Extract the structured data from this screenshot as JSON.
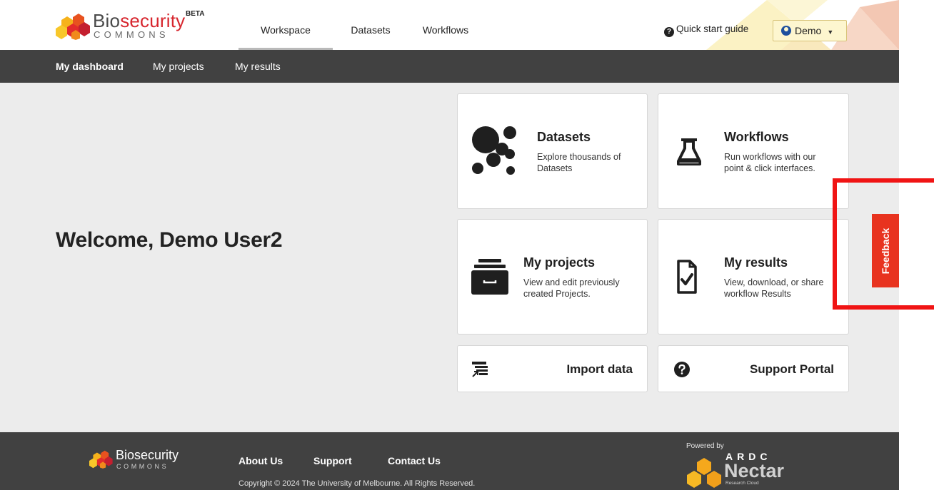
{
  "header": {
    "brand_part1": "Bio",
    "brand_part2": "security",
    "brand_sub": "COMMONS",
    "beta": "BETA",
    "tabs": [
      {
        "label": "Workspace",
        "active": true
      },
      {
        "label": "Datasets",
        "active": false
      },
      {
        "label": "Workflows",
        "active": false
      }
    ],
    "quick_start": "Quick start guide",
    "user_label": "Demo"
  },
  "subnav": {
    "items": [
      {
        "label": "My dashboard",
        "active": true
      },
      {
        "label": "My projects",
        "active": false
      },
      {
        "label": "My results",
        "active": false
      }
    ]
  },
  "main": {
    "welcome": "Welcome, Demo User2",
    "cards": {
      "datasets": {
        "title": "Datasets",
        "desc1": "Explore thousands of",
        "desc2": "Datasets",
        "icon": "datasets-dots-icon"
      },
      "workflows": {
        "title": "Workflows",
        "desc1": "Run workflows with our",
        "desc2": "point & click interfaces.",
        "icon": "flask-icon"
      },
      "projects": {
        "title": "My projects",
        "desc1": "View and edit previously",
        "desc2": "created Projects.",
        "icon": "archive-box-icon"
      },
      "results": {
        "title": "My results",
        "desc1": "View, download, or share",
        "desc2": "workflow Results",
        "icon": "file-check-icon"
      },
      "import": {
        "title": "Import data",
        "icon": "import-icon"
      },
      "support": {
        "title": "Support Portal",
        "icon": "question-circle-icon"
      }
    }
  },
  "feedback": {
    "label": "Feedback"
  },
  "footer": {
    "brand": "Biosecurity",
    "brand_sub": "COMMONS",
    "links": [
      "About Us",
      "Support",
      "Contact Us"
    ],
    "copyright": "Copyright © 2024 The University of Melbourne. All Rights Reserved.",
    "powered_by": "Powered by",
    "ardc": "ARDC",
    "nectar": "Nectar",
    "nectar_sub": "Research Cloud"
  },
  "colors": {
    "brand_red": "#d7262e",
    "subnav_bg": "#414141",
    "page_bg": "#ececec",
    "feedback_red": "#e8331f",
    "user_button_bg": "#fdf6cf",
    "annotation_red": "#f01414"
  }
}
